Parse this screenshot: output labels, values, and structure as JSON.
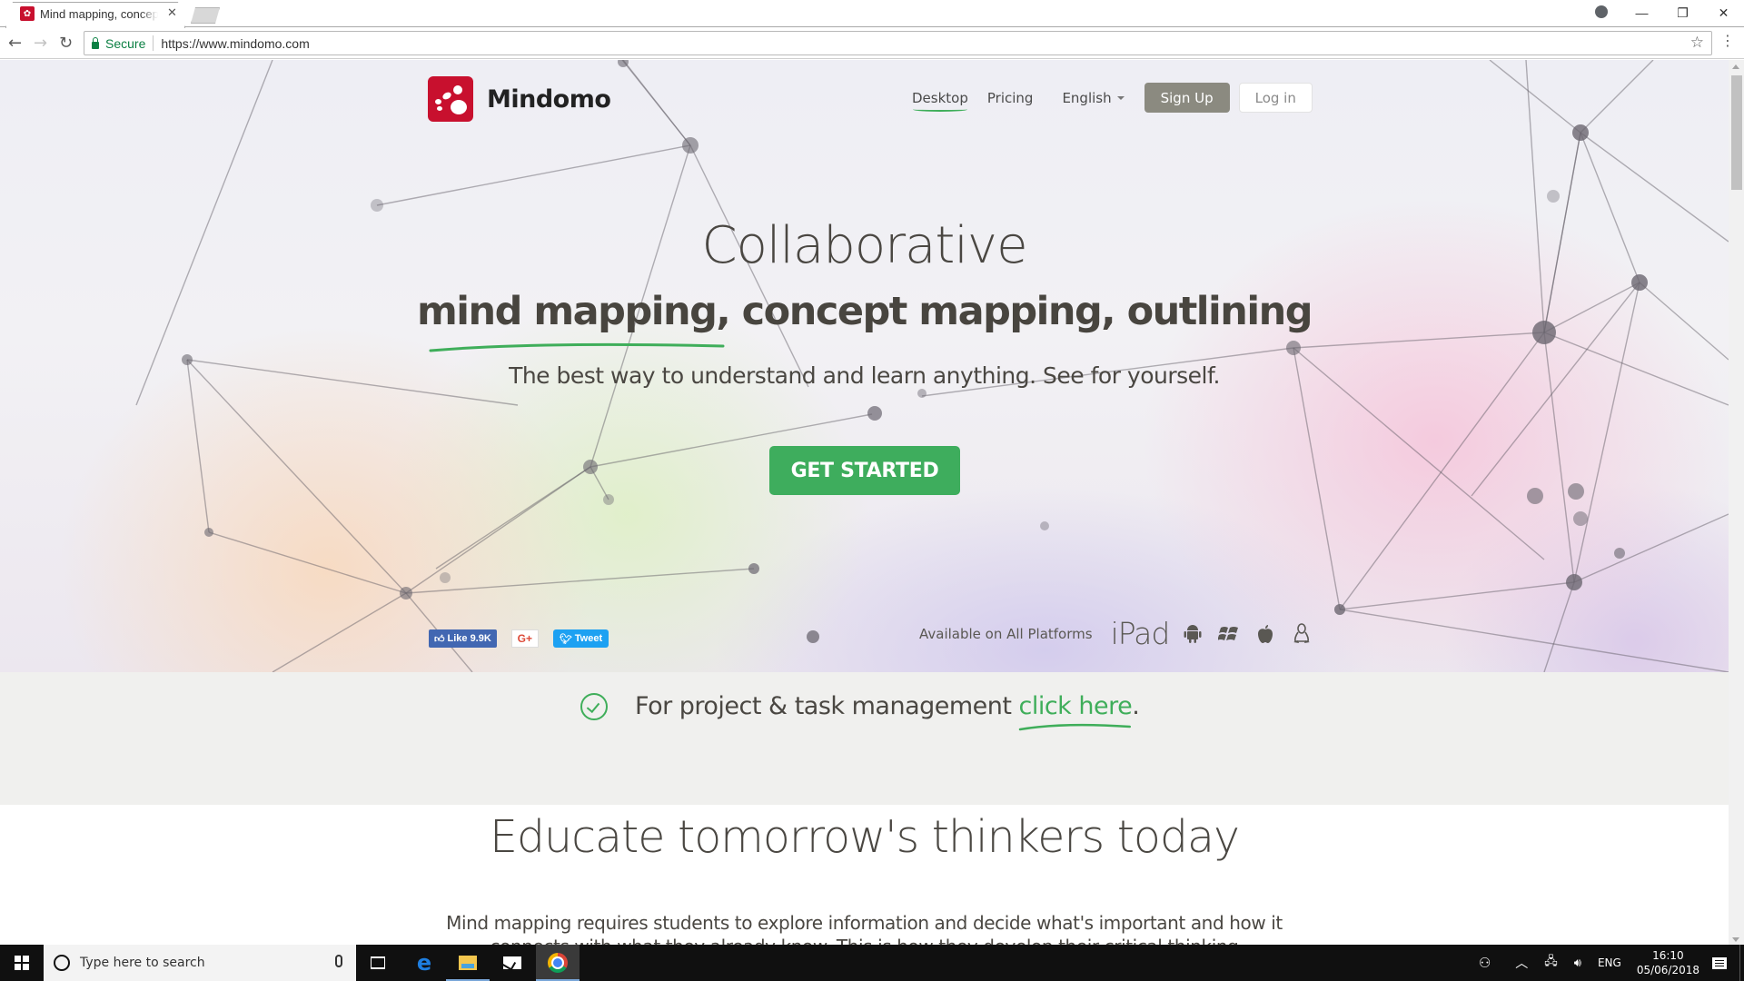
{
  "browser": {
    "tab": {
      "title": "Mind mapping, concept mapping",
      "favicon": "mindomo-favicon"
    },
    "window_controls": {
      "profile": "profile-icon",
      "minimize": "—",
      "restore": "❐",
      "close": "✕"
    },
    "toolbar": {
      "back": "←",
      "forward": "→",
      "reload": "↻",
      "secure_label": "Secure",
      "url": "https://www.mindomo.com",
      "bookmark": "☆",
      "menu": "⋮"
    }
  },
  "page": {
    "logo": {
      "text": "Mindomo",
      "color": "#c8102e"
    },
    "nav": {
      "items": [
        {
          "label": "Desktop",
          "active": true
        },
        {
          "label": "Pricing",
          "active": false
        }
      ],
      "language": "English",
      "signup": "Sign Up",
      "login": "Log in"
    },
    "hero": {
      "title": "Collaborative",
      "subtitle": "mind mapping, concept mapping, outlining",
      "tagline": "The best way to understand and learn anything. See for yourself.",
      "cta": "GET STARTED",
      "accent": "#3ead5d"
    },
    "social": {
      "facebook": "Like 9.9K",
      "google": "G+",
      "twitter": "Tweet"
    },
    "platforms": {
      "label": "Available on All Platforms",
      "ipad": "iPad",
      "icons": [
        "android-icon",
        "windows-icon",
        "apple-icon",
        "linux-icon"
      ]
    },
    "project_band": {
      "text": "For project & task management",
      "link": "click here",
      "punct": "."
    },
    "educate": {
      "title": "Educate tomorrow's thinkers today",
      "body": "Mind mapping requires students to explore information and decide what's important and how it connects with what they already know. This is how they develop their critical thinking"
    }
  },
  "taskbar": {
    "search_placeholder": "Type here to search",
    "apps": [
      "task-view",
      "edge",
      "file-explorer",
      "mail",
      "chrome"
    ],
    "tray": {
      "language": "ENG",
      "time": "16:10",
      "date": "05/06/2018"
    }
  }
}
